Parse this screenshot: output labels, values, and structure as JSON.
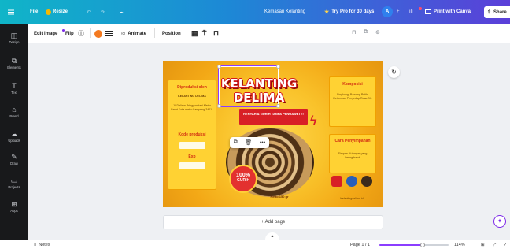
{
  "topbar": {
    "file": "File",
    "resize": "Resize",
    "title": "Kemasan Kelanting",
    "try_pro": "Try Pro for 30 days",
    "avatar_initial": "A",
    "print": "Print with Canva",
    "share": "Share"
  },
  "toolbar": {
    "edit_image": "Edit image",
    "flip": "Flip",
    "animate": "Animate",
    "position": "Position",
    "color": "#f47a20"
  },
  "sidebar": {
    "items": [
      {
        "label": "Design",
        "icon": "design-icon"
      },
      {
        "label": "Elements",
        "icon": "elements-icon"
      },
      {
        "label": "Text",
        "icon": "text-icon"
      },
      {
        "label": "Brand",
        "icon": "brand-icon"
      },
      {
        "label": "Uploads",
        "icon": "uploads-icon"
      },
      {
        "label": "Draw",
        "icon": "draw-icon"
      },
      {
        "label": "Projects",
        "icon": "projects-icon"
      },
      {
        "label": "Apps",
        "icon": "apps-icon"
      }
    ]
  },
  "design": {
    "produced_by_title": "Diproduksi oleh",
    "produced_by_name": "KELANTING DELIMA",
    "produced_by_address": "Jl. Delima Pringgondani Metro Barat Kota metro Lampung 34111",
    "production_code_title": "Kode produksi",
    "exp_title": "Exp",
    "brand_line1": "KELANTING",
    "brand_line2": "DELIMA",
    "tagline": "RENYAH & GURIH TANPA PENGAWET!!!",
    "composition_title": "Komposisi",
    "composition_text": "Singkong, Bawang Putih, Ketumbar, Penyedap Rasa Dll.",
    "storage_title": "Cara Penyimpanan",
    "storage_text": "Simpan di tempat yang kering,bajuk",
    "badge_pct": "100%",
    "badge_word": "GURIH",
    "netto": "Netto 150 gr",
    "instagram": "Kelantingdelima.id"
  },
  "canvas": {
    "add_page": "+ Add page"
  },
  "bottombar": {
    "notes": "Notes",
    "page_info": "Page 1 / 1",
    "zoom": "114%",
    "zoom_fraction": 0.62
  }
}
